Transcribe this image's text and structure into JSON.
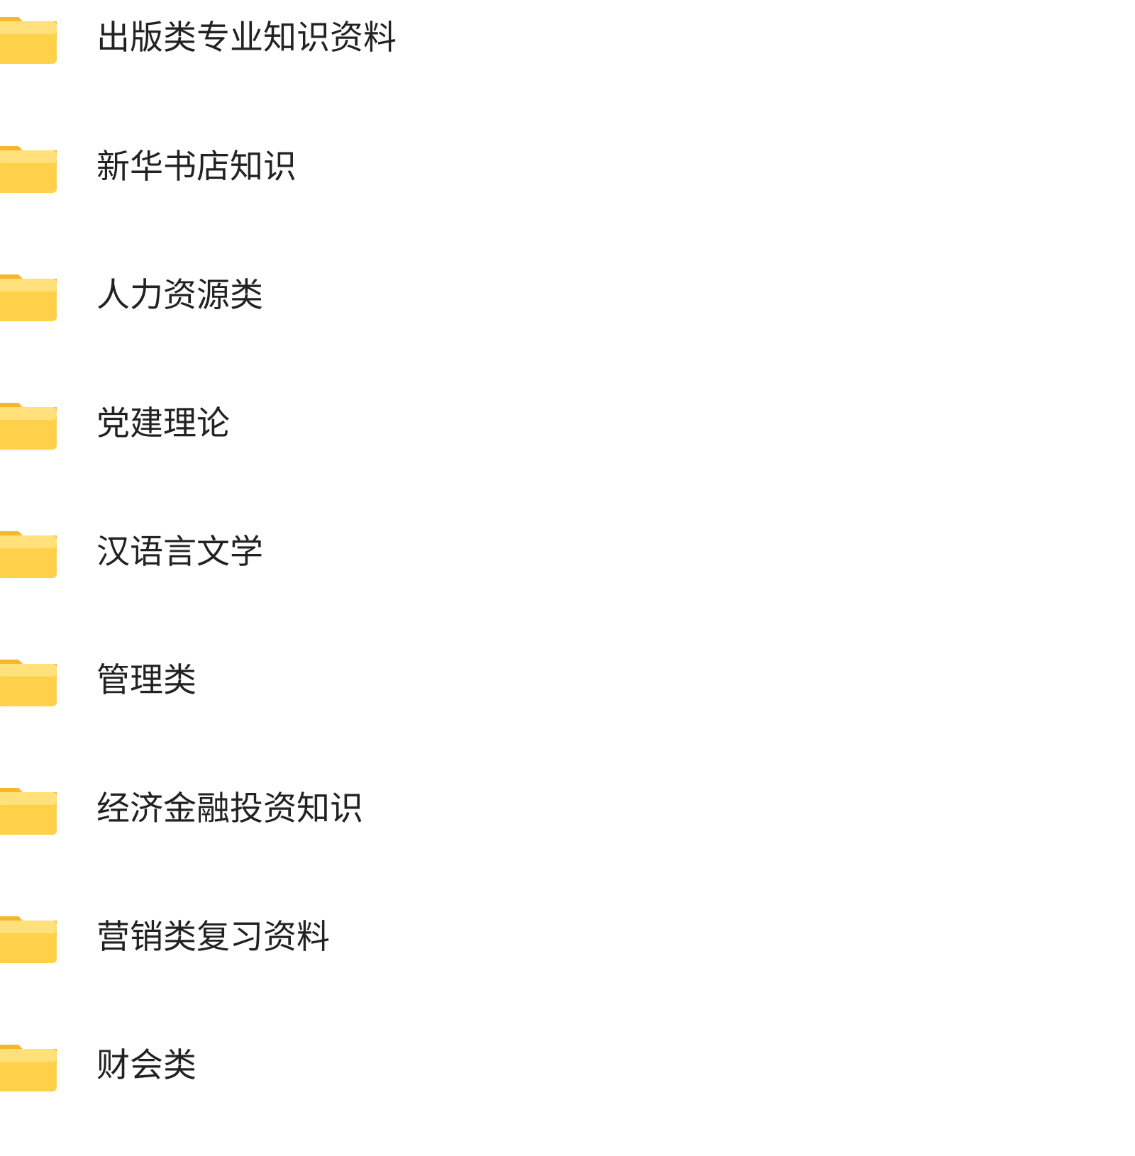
{
  "folders": [
    {
      "name": "出版类专业知识资料",
      "icon": "folder-icon"
    },
    {
      "name": "新华书店知识",
      "icon": "folder-icon"
    },
    {
      "name": "人力资源类",
      "icon": "folder-icon"
    },
    {
      "name": "党建理论",
      "icon": "folder-icon"
    },
    {
      "name": "汉语言文学",
      "icon": "folder-icon"
    },
    {
      "name": "管理类",
      "icon": "folder-icon"
    },
    {
      "name": "经济金融投资知识",
      "icon": "folder-icon"
    },
    {
      "name": "营销类复习资料",
      "icon": "folder-icon"
    },
    {
      "name": "财会类",
      "icon": "folder-icon"
    }
  ],
  "colors": {
    "folder_fill": "#FFD04A",
    "folder_top": "#FFE07A",
    "folder_tab": "#F6B82A",
    "text": "#222222",
    "background": "#FFFFFF"
  }
}
